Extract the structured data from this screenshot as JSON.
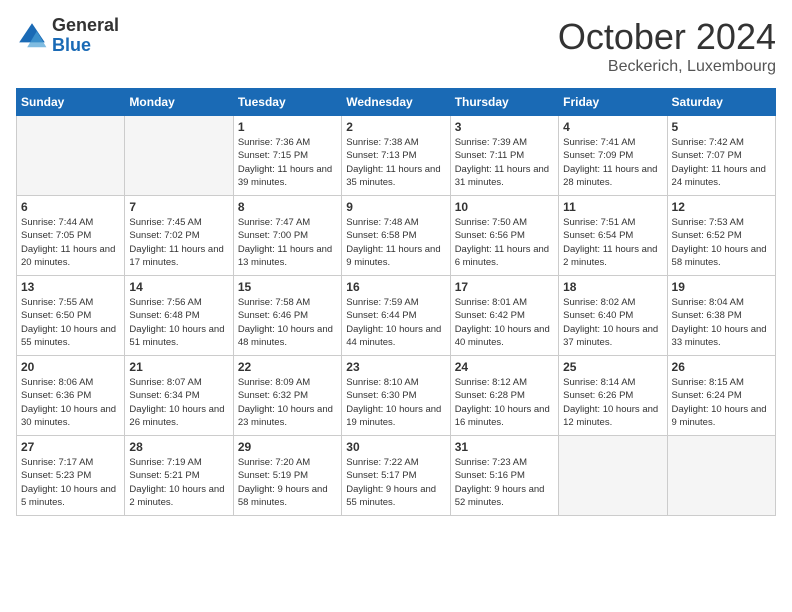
{
  "logo": {
    "general": "General",
    "blue": "Blue"
  },
  "title": {
    "month": "October 2024",
    "location": "Beckerich, Luxembourg"
  },
  "days_of_week": [
    "Sunday",
    "Monday",
    "Tuesday",
    "Wednesday",
    "Thursday",
    "Friday",
    "Saturday"
  ],
  "weeks": [
    [
      {
        "day": "",
        "empty": true
      },
      {
        "day": "",
        "empty": true
      },
      {
        "day": "1",
        "sunrise": "Sunrise: 7:36 AM",
        "sunset": "Sunset: 7:15 PM",
        "daylight": "Daylight: 11 hours and 39 minutes."
      },
      {
        "day": "2",
        "sunrise": "Sunrise: 7:38 AM",
        "sunset": "Sunset: 7:13 PM",
        "daylight": "Daylight: 11 hours and 35 minutes."
      },
      {
        "day": "3",
        "sunrise": "Sunrise: 7:39 AM",
        "sunset": "Sunset: 7:11 PM",
        "daylight": "Daylight: 11 hours and 31 minutes."
      },
      {
        "day": "4",
        "sunrise": "Sunrise: 7:41 AM",
        "sunset": "Sunset: 7:09 PM",
        "daylight": "Daylight: 11 hours and 28 minutes."
      },
      {
        "day": "5",
        "sunrise": "Sunrise: 7:42 AM",
        "sunset": "Sunset: 7:07 PM",
        "daylight": "Daylight: 11 hours and 24 minutes."
      }
    ],
    [
      {
        "day": "6",
        "sunrise": "Sunrise: 7:44 AM",
        "sunset": "Sunset: 7:05 PM",
        "daylight": "Daylight: 11 hours and 20 minutes."
      },
      {
        "day": "7",
        "sunrise": "Sunrise: 7:45 AM",
        "sunset": "Sunset: 7:02 PM",
        "daylight": "Daylight: 11 hours and 17 minutes."
      },
      {
        "day": "8",
        "sunrise": "Sunrise: 7:47 AM",
        "sunset": "Sunset: 7:00 PM",
        "daylight": "Daylight: 11 hours and 13 minutes."
      },
      {
        "day": "9",
        "sunrise": "Sunrise: 7:48 AM",
        "sunset": "Sunset: 6:58 PM",
        "daylight": "Daylight: 11 hours and 9 minutes."
      },
      {
        "day": "10",
        "sunrise": "Sunrise: 7:50 AM",
        "sunset": "Sunset: 6:56 PM",
        "daylight": "Daylight: 11 hours and 6 minutes."
      },
      {
        "day": "11",
        "sunrise": "Sunrise: 7:51 AM",
        "sunset": "Sunset: 6:54 PM",
        "daylight": "Daylight: 11 hours and 2 minutes."
      },
      {
        "day": "12",
        "sunrise": "Sunrise: 7:53 AM",
        "sunset": "Sunset: 6:52 PM",
        "daylight": "Daylight: 10 hours and 58 minutes."
      }
    ],
    [
      {
        "day": "13",
        "sunrise": "Sunrise: 7:55 AM",
        "sunset": "Sunset: 6:50 PM",
        "daylight": "Daylight: 10 hours and 55 minutes."
      },
      {
        "day": "14",
        "sunrise": "Sunrise: 7:56 AM",
        "sunset": "Sunset: 6:48 PM",
        "daylight": "Daylight: 10 hours and 51 minutes."
      },
      {
        "day": "15",
        "sunrise": "Sunrise: 7:58 AM",
        "sunset": "Sunset: 6:46 PM",
        "daylight": "Daylight: 10 hours and 48 minutes."
      },
      {
        "day": "16",
        "sunrise": "Sunrise: 7:59 AM",
        "sunset": "Sunset: 6:44 PM",
        "daylight": "Daylight: 10 hours and 44 minutes."
      },
      {
        "day": "17",
        "sunrise": "Sunrise: 8:01 AM",
        "sunset": "Sunset: 6:42 PM",
        "daylight": "Daylight: 10 hours and 40 minutes."
      },
      {
        "day": "18",
        "sunrise": "Sunrise: 8:02 AM",
        "sunset": "Sunset: 6:40 PM",
        "daylight": "Daylight: 10 hours and 37 minutes."
      },
      {
        "day": "19",
        "sunrise": "Sunrise: 8:04 AM",
        "sunset": "Sunset: 6:38 PM",
        "daylight": "Daylight: 10 hours and 33 minutes."
      }
    ],
    [
      {
        "day": "20",
        "sunrise": "Sunrise: 8:06 AM",
        "sunset": "Sunset: 6:36 PM",
        "daylight": "Daylight: 10 hours and 30 minutes."
      },
      {
        "day": "21",
        "sunrise": "Sunrise: 8:07 AM",
        "sunset": "Sunset: 6:34 PM",
        "daylight": "Daylight: 10 hours and 26 minutes."
      },
      {
        "day": "22",
        "sunrise": "Sunrise: 8:09 AM",
        "sunset": "Sunset: 6:32 PM",
        "daylight": "Daylight: 10 hours and 23 minutes."
      },
      {
        "day": "23",
        "sunrise": "Sunrise: 8:10 AM",
        "sunset": "Sunset: 6:30 PM",
        "daylight": "Daylight: 10 hours and 19 minutes."
      },
      {
        "day": "24",
        "sunrise": "Sunrise: 8:12 AM",
        "sunset": "Sunset: 6:28 PM",
        "daylight": "Daylight: 10 hours and 16 minutes."
      },
      {
        "day": "25",
        "sunrise": "Sunrise: 8:14 AM",
        "sunset": "Sunset: 6:26 PM",
        "daylight": "Daylight: 10 hours and 12 minutes."
      },
      {
        "day": "26",
        "sunrise": "Sunrise: 8:15 AM",
        "sunset": "Sunset: 6:24 PM",
        "daylight": "Daylight: 10 hours and 9 minutes."
      }
    ],
    [
      {
        "day": "27",
        "sunrise": "Sunrise: 7:17 AM",
        "sunset": "Sunset: 5:23 PM",
        "daylight": "Daylight: 10 hours and 5 minutes."
      },
      {
        "day": "28",
        "sunrise": "Sunrise: 7:19 AM",
        "sunset": "Sunset: 5:21 PM",
        "daylight": "Daylight: 10 hours and 2 minutes."
      },
      {
        "day": "29",
        "sunrise": "Sunrise: 7:20 AM",
        "sunset": "Sunset: 5:19 PM",
        "daylight": "Daylight: 9 hours and 58 minutes."
      },
      {
        "day": "30",
        "sunrise": "Sunrise: 7:22 AM",
        "sunset": "Sunset: 5:17 PM",
        "daylight": "Daylight: 9 hours and 55 minutes."
      },
      {
        "day": "31",
        "sunrise": "Sunrise: 7:23 AM",
        "sunset": "Sunset: 5:16 PM",
        "daylight": "Daylight: 9 hours and 52 minutes."
      },
      {
        "day": "",
        "empty": true
      },
      {
        "day": "",
        "empty": true
      }
    ]
  ]
}
